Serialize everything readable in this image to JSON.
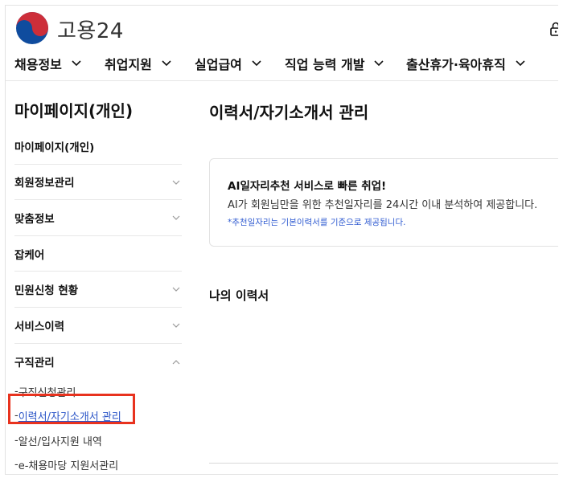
{
  "header": {
    "logo_text": "고용24",
    "gnb": [
      {
        "label": "채용정보"
      },
      {
        "label": "취업지원"
      },
      {
        "label": "실업급여"
      },
      {
        "label": "직업 능력 개발"
      },
      {
        "label": "출산휴가·육아휴직"
      }
    ]
  },
  "sidebar": {
    "title": "마이페이지(개인)",
    "items": [
      {
        "label": "마이페이지(개인)",
        "chevron": "none"
      },
      {
        "label": "회원정보관리",
        "chevron": "chevron-down"
      },
      {
        "label": "맞춤정보",
        "chevron": "chevron-down"
      },
      {
        "label": "잡케어",
        "chevron": "none"
      },
      {
        "label": "민원신청 현황",
        "chevron": "chevron-down"
      },
      {
        "label": "서비스이력",
        "chevron": "chevron-down"
      },
      {
        "label": "구직관리",
        "chevron": "chevron-up"
      }
    ],
    "sub_items": [
      {
        "label": "구직신청관리"
      },
      {
        "label": "이력서/자기소개서 관리",
        "active": true
      },
      {
        "label": "알선/입사지원 내역"
      },
      {
        "label": "e-채용마당 지원서관리"
      }
    ]
  },
  "main": {
    "title": "이력서/자기소개서 관리",
    "info": {
      "heading": "AI일자리추천 서비스로 빠른 취업!",
      "body": "AI가 회원님만을 위한 추천일자리를 24시간 이내 분석하여 제공합니다.",
      "note": "*추천일자리는 기본이력서를 기준으로 제공됩니다."
    },
    "section_title": "나의 이력서"
  },
  "colors": {
    "accent_link": "#2b55c7",
    "highlight_box": "#e8321e",
    "logo_red": "#cd2e3a",
    "logo_blue": "#0f4c9e"
  }
}
